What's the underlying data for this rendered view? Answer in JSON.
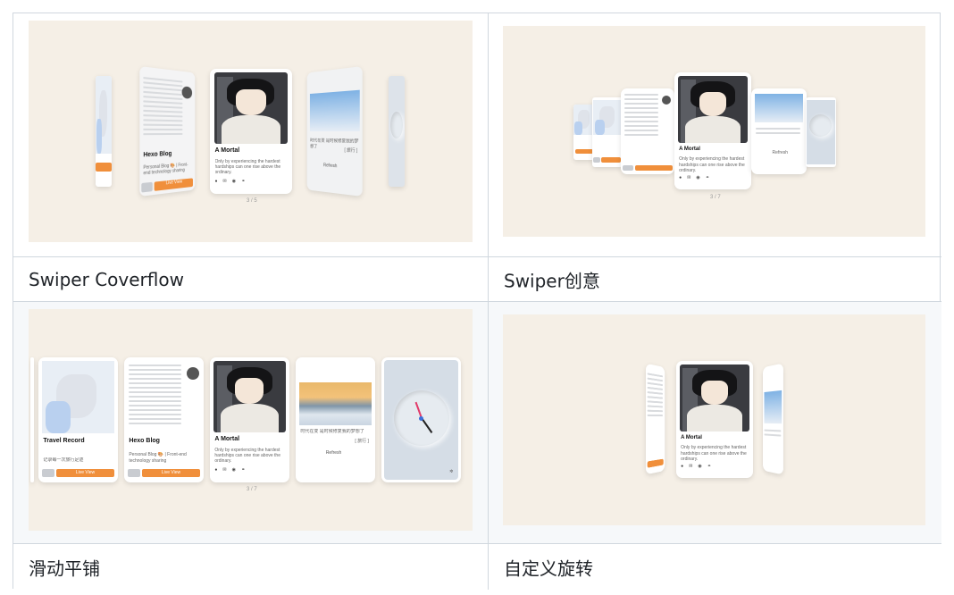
{
  "captions": {
    "coverflow": "Swiper Coverflow",
    "creative": "Swiper创意",
    "slide": "滑动平铺",
    "rotate": "自定义旋转"
  },
  "colors": {
    "preview_bg": "#f5efe6",
    "accent_orange": "#f08f3b",
    "border": "#d0d7de"
  },
  "card": {
    "title": "A Mortal",
    "body": "Only by experiencing the hardest hardships can one rise above the ordinary.",
    "icons": [
      "bilibili-icon",
      "mail-icon",
      "github-icon",
      "link-icon"
    ]
  },
  "blog_card": {
    "title": "Hexo Blog",
    "body": "Personal Blog 🎨 | Front-end technology sharing",
    "button": "Live View"
  },
  "travel_card": {
    "title": "Travel Record",
    "body": "记录每一次旅行足迹",
    "button": "Live View"
  },
  "photo_card": {
    "text": "时代在变 是时候修复我的梦想了",
    "tag": "[ 旅行 ]",
    "button": "Refresh"
  },
  "pagers": {
    "coverflow": "3 / 5",
    "creative": "3 / 7",
    "slide": "3 / 7"
  }
}
